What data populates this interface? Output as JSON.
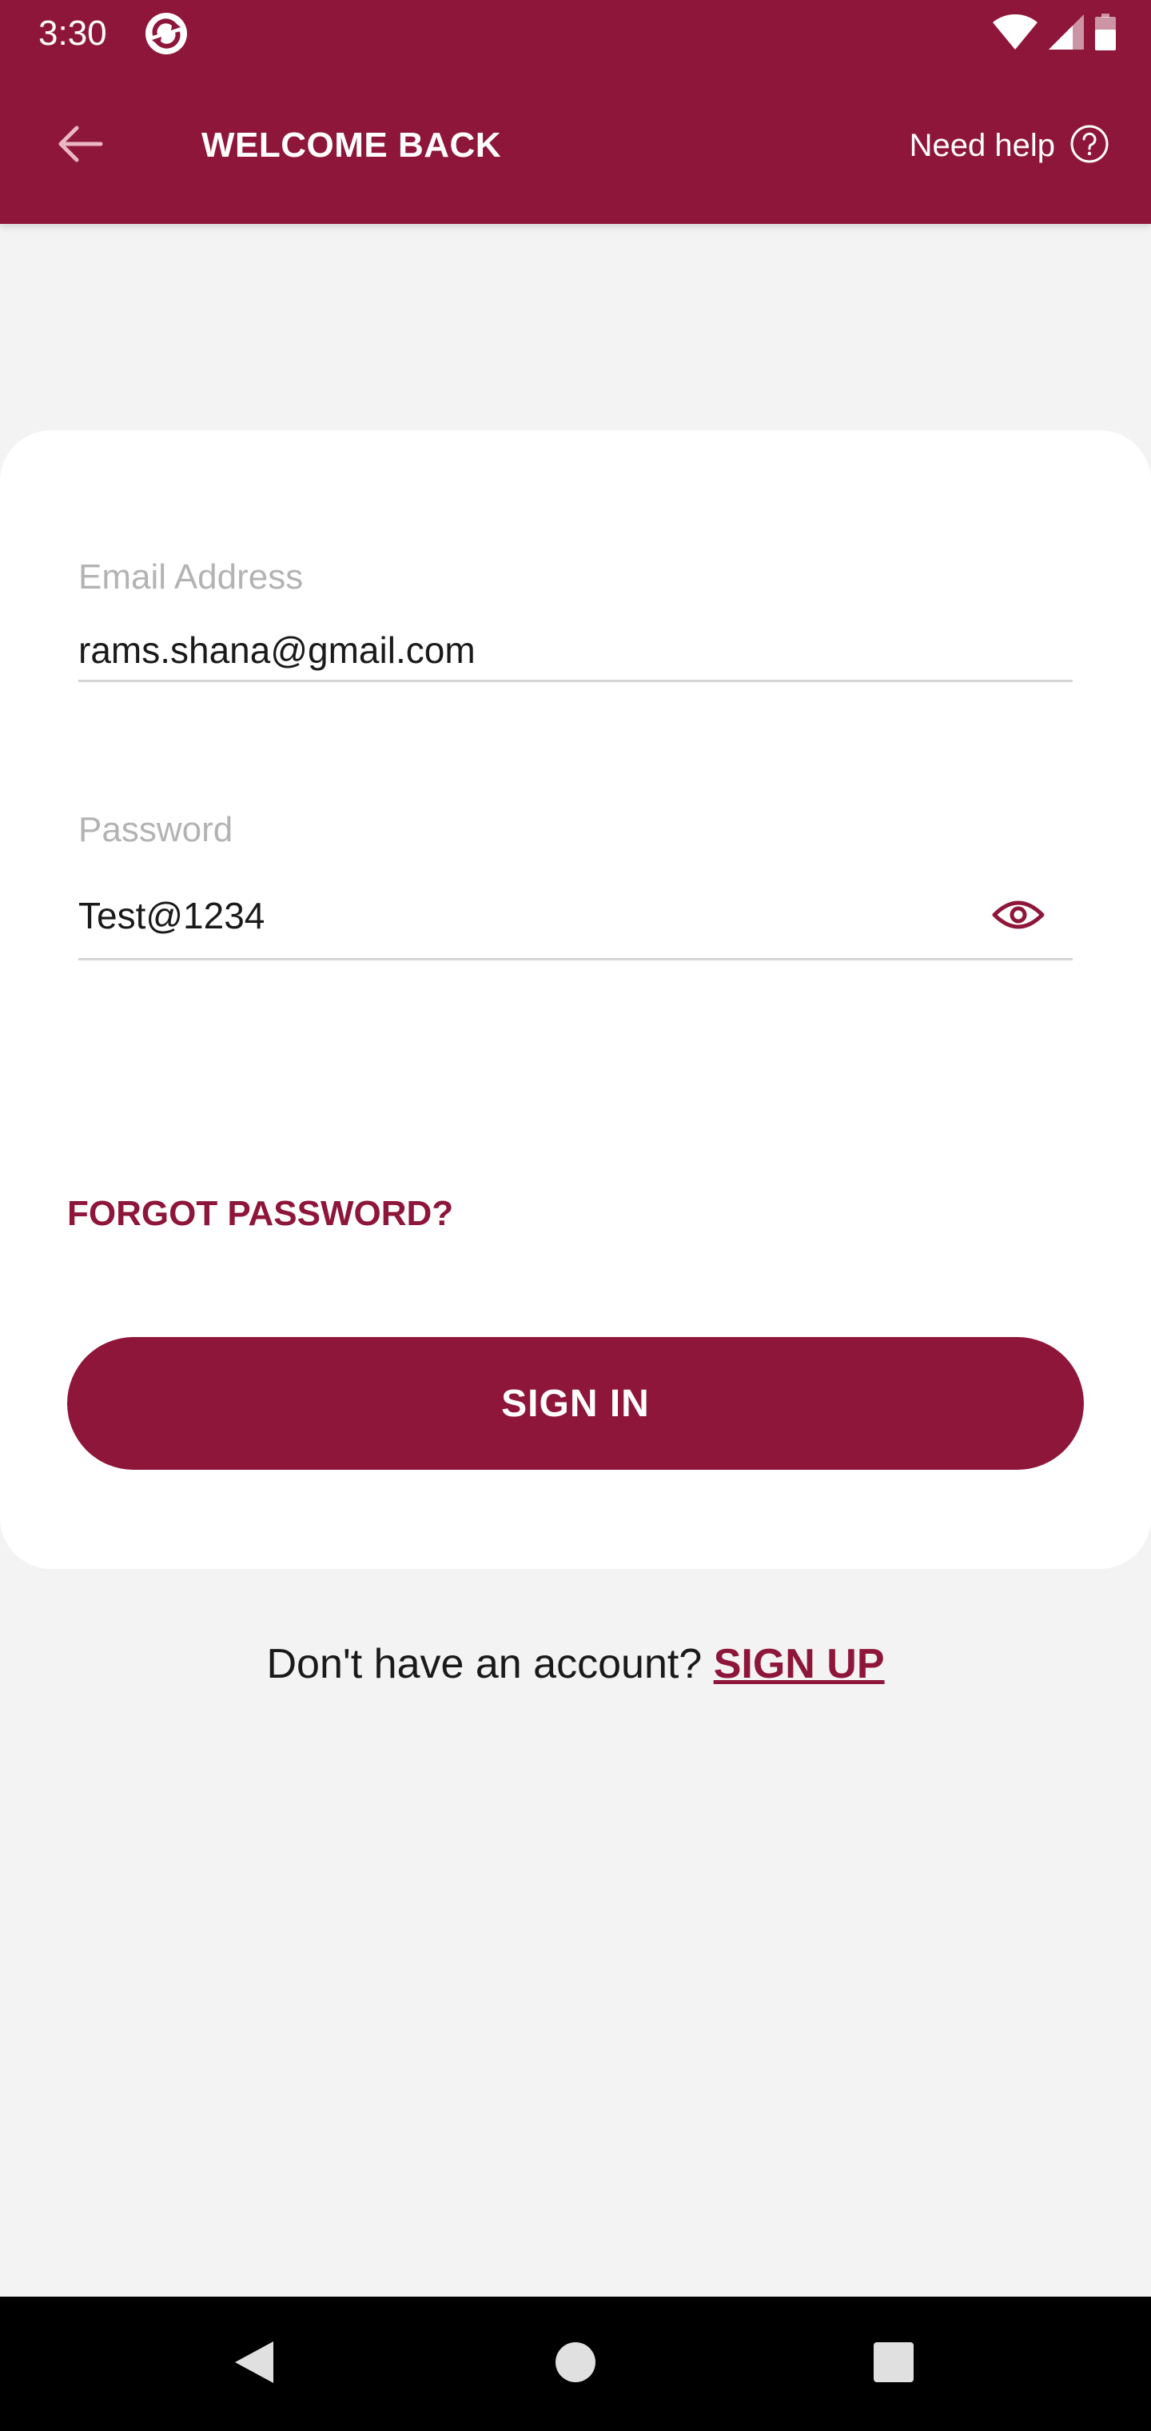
{
  "status_bar": {
    "time": "3:30",
    "icons": [
      "app-sync-icon",
      "wifi-icon",
      "signal-icon",
      "battery-icon"
    ]
  },
  "toolbar": {
    "title": "WELCOME BACK",
    "help_label": "Need help",
    "back_icon": "arrow-left-icon",
    "help_icon": "question-circle-icon"
  },
  "form": {
    "email": {
      "label": "Email Address",
      "value": "rams.shana@gmail.com"
    },
    "password": {
      "label": "Password",
      "value": "Test@1234",
      "toggle_icon": "eye-icon"
    },
    "forgot_password": "FORGOT PASSWORD?",
    "sign_in_button": "SIGN IN"
  },
  "signup": {
    "prompt": "Don't have an account?",
    "link": "SIGN UP"
  },
  "nav_bar": {
    "buttons": [
      "back-triangle-icon",
      "home-circle-icon",
      "recents-square-icon"
    ]
  },
  "colors": {
    "brand": "#8e163a",
    "background": "#f3f3f3",
    "card": "#ffffff",
    "label": "#b3b3b3",
    "nav_bar": "#000000"
  }
}
